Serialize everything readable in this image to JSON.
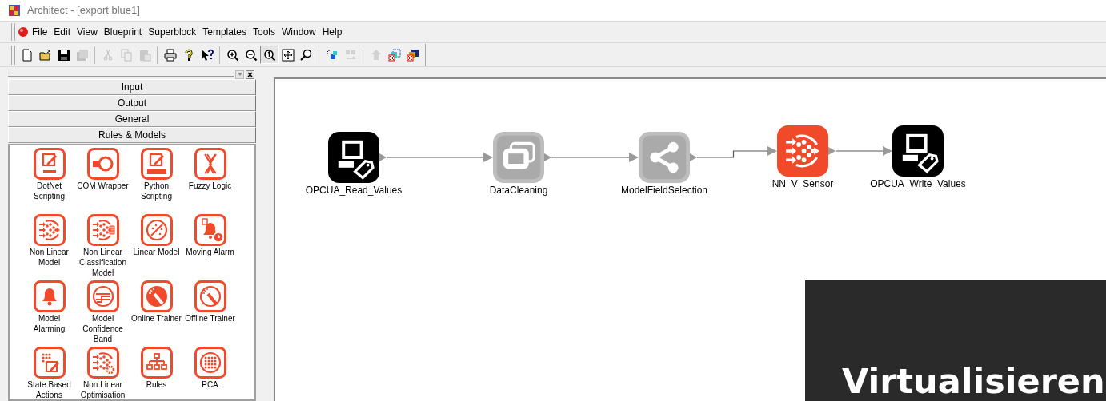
{
  "window": {
    "title": "Architect - [export blue1]"
  },
  "menu": [
    "File",
    "Edit",
    "View",
    "Blueprint",
    "Superblock",
    "Templates",
    "Tools",
    "Window",
    "Help"
  ],
  "toolbar": [
    {
      "kind": "new",
      "disabled": false,
      "pressed": false
    },
    {
      "kind": "open",
      "disabled": false,
      "pressed": false
    },
    {
      "kind": "save",
      "disabled": false,
      "pressed": false
    },
    {
      "kind": "saveall",
      "disabled": true,
      "pressed": false
    },
    {
      "kind": "sep"
    },
    {
      "kind": "cut",
      "disabled": true,
      "pressed": false
    },
    {
      "kind": "copy",
      "disabled": true,
      "pressed": false
    },
    {
      "kind": "paste",
      "disabled": true,
      "pressed": false
    },
    {
      "kind": "sep"
    },
    {
      "kind": "print",
      "disabled": false,
      "pressed": false
    },
    {
      "kind": "help",
      "disabled": false,
      "pressed": false
    },
    {
      "kind": "contexthelp",
      "disabled": false,
      "pressed": false
    },
    {
      "kind": "sep"
    },
    {
      "kind": "zoomin",
      "disabled": false,
      "pressed": false
    },
    {
      "kind": "zoomout",
      "disabled": false,
      "pressed": false
    },
    {
      "kind": "zoom100",
      "disabled": false,
      "pressed": true
    },
    {
      "kind": "fit",
      "disabled": false,
      "pressed": false
    },
    {
      "kind": "find",
      "disabled": false,
      "pressed": false
    },
    {
      "kind": "sep"
    },
    {
      "kind": "blocks",
      "disabled": false,
      "pressed": false
    },
    {
      "kind": "swap",
      "disabled": true,
      "pressed": false
    },
    {
      "kind": "sep"
    },
    {
      "kind": "up",
      "disabled": true,
      "pressed": false
    },
    {
      "kind": "removeblocks",
      "disabled": false,
      "pressed": false
    },
    {
      "kind": "removestack",
      "disabled": false,
      "pressed": false
    }
  ],
  "palette": {
    "sections": [
      {
        "title": "Input"
      },
      {
        "title": "Output"
      },
      {
        "title": "General"
      },
      {
        "title": "Rules & Models",
        "items": [
          {
            "label": "DotNet Scripting",
            "kind": "dotnet"
          },
          {
            "label": "COM Wrapper",
            "kind": "com"
          },
          {
            "label": "Python Scripting",
            "kind": "python"
          },
          {
            "label": "Fuzzy Logic",
            "kind": "fuzzy"
          },
          {
            "label": "Non Linear Model",
            "kind": "neural"
          },
          {
            "label": "Non Linear Classification Model",
            "kind": "neuralgrid"
          },
          {
            "label": "Linear Model",
            "kind": "linear"
          },
          {
            "label": "Moving Alarm",
            "kind": "bellclock"
          },
          {
            "label": "Model Alarming",
            "kind": "bell"
          },
          {
            "label": "Model Confidence Band",
            "kind": "band"
          },
          {
            "label": "Online Trainer",
            "kind": "wandfilled"
          },
          {
            "label": "Offline Trainer",
            "kind": "wand"
          },
          {
            "label": "State Based Actions",
            "kind": "state"
          },
          {
            "label": "Non Linear Optimisation",
            "kind": "neuralgear"
          },
          {
            "label": "Rules",
            "kind": "tree"
          },
          {
            "label": "PCA",
            "kind": "pca"
          }
        ]
      }
    ]
  },
  "canvas": {
    "nodes": [
      {
        "label": "OPCUA_Read_Values",
        "kind": "terminal",
        "disabled": false
      },
      {
        "label": "DataCleaning",
        "kind": "windows",
        "disabled": true
      },
      {
        "label": "ModelFieldSelection",
        "kind": "share",
        "disabled": true
      },
      {
        "label": "NN_V_Sensor",
        "kind": "neural",
        "disabled": false
      },
      {
        "label": "OPCUA_Write_Values",
        "kind": "terminal",
        "disabled": false
      }
    ]
  },
  "overlay": {
    "text": "Virtualisieren"
  }
}
